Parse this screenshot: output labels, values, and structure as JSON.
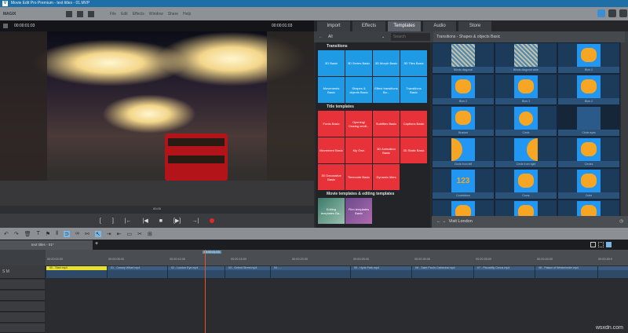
{
  "window": {
    "title": "Movie Edit Pro Premium - text titles - 01.MVP"
  },
  "menubar": {
    "brand": "MAGIX",
    "items": [
      "File",
      "Edit",
      "Effects",
      "Window",
      "Share",
      "Help"
    ]
  },
  "preview": {
    "timecode_left": "00:00:01:03",
    "timecode_right": "00:00:01:03",
    "scrub_time": "00:00",
    "controls": [
      "[",
      "]",
      "|←",
      "|◀",
      "■",
      "[▶]",
      "→|"
    ]
  },
  "panel": {
    "tabs": [
      "Import",
      "Effects",
      "Templates",
      "Audio",
      "Store"
    ],
    "active_tab": "Templates",
    "filter": {
      "value": "All",
      "search_placeholder": "Search"
    },
    "breadcrumb": "Transitions - Shapes & objects Basic",
    "sections": [
      {
        "title": "Transitions",
        "color": "#1f9be6",
        "items": [
          "3D Basic",
          "3D Series Basic",
          "3D Morph Basic",
          "3D Tiles Basic",
          "Movements Basic",
          "Shapes & objects Basic",
          "Effect transitions Ba...",
          "Transitions Basic"
        ]
      },
      {
        "title": "Title templates",
        "color": "#e8323a",
        "items": [
          "Fonts Basic",
          "Opening/ Closing credi...",
          "Subtitles Basic",
          "Captions Basic",
          "Movement Basic",
          "My Own",
          "3D Animation Basic",
          "3D Static Basic",
          "3D Decorative Basic",
          "Timecode Basic",
          "Dynamic titles"
        ]
      },
      {
        "title": "Movie templates & editing templates",
        "items": [
          "Editing templates Ba...",
          "Film templates Basic"
        ]
      }
    ],
    "shapes": [
      "Blinds diagonal",
      "Blinds diagonal wide",
      "Blob 1",
      "Blob 2",
      "Blob 3",
      "Blob 4",
      "Bracket",
      "Circle",
      "Circle eyes",
      "Circle from left",
      "Circle from right",
      "Circles",
      "Countdown",
      "Cross",
      "Cube",
      "",
      "",
      ""
    ],
    "footer": "Visit London"
  },
  "timeline": {
    "project_tab": "text titles - 01*",
    "playhead_label": "00:00:11:03",
    "ruler": [
      "00:00:00:00",
      "00:00:05:00",
      "00:00:10:00",
      "00:00:15:00",
      "00:00:20:00",
      "00:00:25:00",
      "00:00:30:00",
      "00:00:35:00",
      "00:00:40:00",
      "00:00:45:0"
    ],
    "clips": [
      "00 - Start.mp4",
      "01 - Canary Wharf.mp4",
      "02 - London Eye.mp4",
      "03 - Oxford Street.mp4",
      "04 - ...",
      "05 - Hyde Park.mp4",
      "06 - Saint Paul's Cathedral.mp4",
      "07 - Piccadilly Circus.mp4",
      "08 - Palace of Westminster.mp4",
      ""
    ],
    "track_label": "S M"
  },
  "watermark": "wsxdn.com"
}
